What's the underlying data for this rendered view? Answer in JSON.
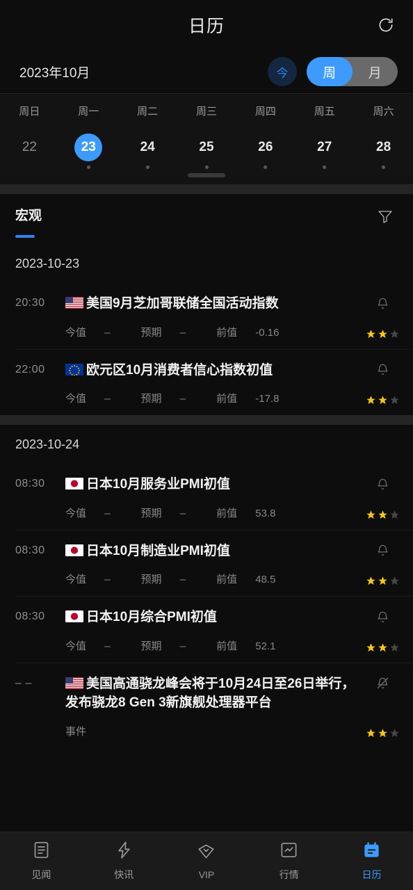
{
  "header": {
    "title": "日历",
    "refresh_icon": "refresh-icon",
    "month_label": "2023年10月",
    "today_label": "今",
    "view_toggle": {
      "options": [
        "周",
        "月"
      ],
      "selected": "周"
    }
  },
  "week": {
    "dow": [
      "周日",
      "周一",
      "周二",
      "周三",
      "周四",
      "周五",
      "周六"
    ],
    "days": [
      {
        "num": "22",
        "selected": false,
        "dot": false,
        "muted": true
      },
      {
        "num": "23",
        "selected": true,
        "dot": true,
        "muted": false
      },
      {
        "num": "24",
        "selected": false,
        "dot": true,
        "muted": false
      },
      {
        "num": "25",
        "selected": false,
        "dot": true,
        "muted": false
      },
      {
        "num": "26",
        "selected": false,
        "dot": true,
        "muted": false
      },
      {
        "num": "27",
        "selected": false,
        "dot": true,
        "muted": false
      },
      {
        "num": "28",
        "selected": false,
        "dot": true,
        "muted": false
      }
    ]
  },
  "tabs": {
    "items": [
      {
        "label": "宏观",
        "active": true
      }
    ],
    "filter_icon": "filter-icon"
  },
  "groups": [
    {
      "date": "2023-10-23",
      "events": [
        {
          "time": "20:30",
          "flag": "us",
          "title": "美国9月芝加哥联储全国活动指数",
          "actual_label": "今值",
          "actual": "–",
          "forecast_label": "预期",
          "forecast": "–",
          "previous_label": "前值",
          "previous": "-0.16",
          "bell": "bell-icon",
          "stars": 2,
          "stars_total": 3
        },
        {
          "time": "22:00",
          "flag": "eu",
          "title": "欧元区10月消费者信心指数初值",
          "actual_label": "今值",
          "actual": "–",
          "forecast_label": "预期",
          "forecast": "–",
          "previous_label": "前值",
          "previous": "-17.8",
          "bell": "bell-icon",
          "stars": 2,
          "stars_total": 3
        }
      ]
    },
    {
      "date": "2023-10-24",
      "events": [
        {
          "time": "08:30",
          "flag": "jp",
          "title": "日本10月服务业PMI初值",
          "actual_label": "今值",
          "actual": "–",
          "forecast_label": "预期",
          "forecast": "–",
          "previous_label": "前值",
          "previous": "53.8",
          "bell": "bell-icon",
          "stars": 2,
          "stars_total": 3
        },
        {
          "time": "08:30",
          "flag": "jp",
          "title": "日本10月制造业PMI初值",
          "actual_label": "今值",
          "actual": "–",
          "forecast_label": "预期",
          "forecast": "–",
          "previous_label": "前值",
          "previous": "48.5",
          "bell": "bell-icon",
          "stars": 2,
          "stars_total": 3
        },
        {
          "time": "08:30",
          "flag": "jp",
          "title": "日本10月综合PMI初值",
          "actual_label": "今值",
          "actual": "–",
          "forecast_label": "预期",
          "forecast": "–",
          "previous_label": "前值",
          "previous": "52.1",
          "bell": "bell-icon",
          "stars": 2,
          "stars_total": 3
        },
        {
          "time": "– –",
          "flag": "us",
          "title": "美国高通骁龙峰会将于10月24日至26日举行，发布骁龙8 Gen 3新旗舰处理器平台",
          "kind_label": "事件",
          "bell": "bell-off-icon",
          "stars": 2,
          "stars_total": 3
        }
      ]
    }
  ],
  "bottom_nav": [
    {
      "label": "见闻",
      "icon": "news-icon",
      "active": false
    },
    {
      "label": "快讯",
      "icon": "flash-icon",
      "active": false
    },
    {
      "label": "VIP",
      "icon": "diamond-icon",
      "active": false
    },
    {
      "label": "行情",
      "icon": "chart-icon",
      "active": false
    },
    {
      "label": "日历",
      "icon": "calendar-icon",
      "active": true
    }
  ],
  "colors": {
    "accent": "#3d9bfd",
    "background": "#0d0d0d",
    "star_on": "#f5c518",
    "star_off": "#4a4a4a"
  }
}
